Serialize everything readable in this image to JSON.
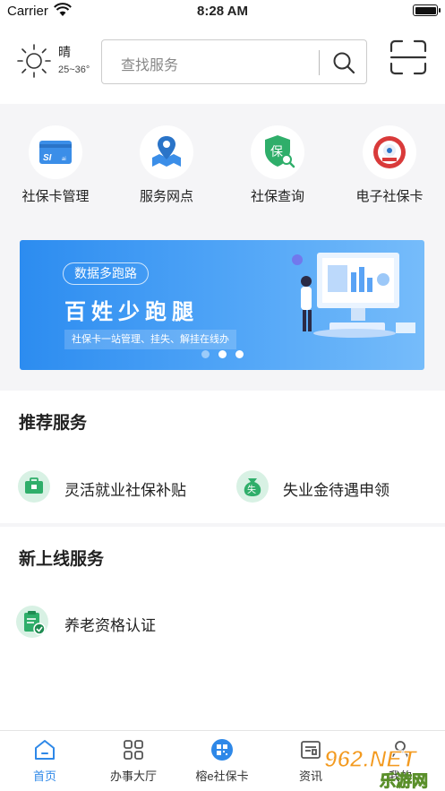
{
  "status_bar": {
    "carrier": "Carrier",
    "time": "8:28 AM"
  },
  "header": {
    "weather": {
      "condition": "晴",
      "temperature": "25~36°",
      "icon": "sun-icon"
    },
    "search": {
      "placeholder": "查找服务",
      "icon": "search-icon"
    },
    "scan": {
      "icon": "scan-icon"
    }
  },
  "quick_actions": [
    {
      "label": "社保卡管理",
      "icon": "si-card-icon"
    },
    {
      "label": "服务网点",
      "icon": "map-pin-icon"
    },
    {
      "label": "社保查询",
      "icon": "shield-search-icon"
    },
    {
      "label": "电子社保卡",
      "icon": "social-security-seal-icon"
    }
  ],
  "banner": {
    "tag": "数据多跑路",
    "headline": "百姓少跑腿",
    "subline": "社保卡一站管理、挂失、解挂在线办",
    "slide_count": 3,
    "active_slide": 1
  },
  "recommended": {
    "title": "推荐服务",
    "items": [
      {
        "label": "灵活就业社保补贴",
        "icon": "briefcase-icon"
      },
      {
        "label": "失业金待遇申领",
        "icon": "money-bag-icon"
      }
    ]
  },
  "new_services": {
    "title": "新上线服务",
    "items": [
      {
        "label": "养老资格认证",
        "icon": "clipboard-check-icon"
      }
    ]
  },
  "tab_bar": [
    {
      "label": "首页",
      "icon": "home-icon",
      "active": true
    },
    {
      "label": "办事大厅",
      "icon": "grid-icon",
      "active": false
    },
    {
      "label": "榕e社保卡",
      "icon": "qr-badge-icon",
      "active": false
    },
    {
      "label": "资讯",
      "icon": "news-icon",
      "active": false
    },
    {
      "label": "我的",
      "icon": "user-icon",
      "active": false
    }
  ],
  "watermark": {
    "brand": "962.NET",
    "caption": "乐游网"
  },
  "colors": {
    "accent": "#2e88e8",
    "green": "#2fae6a",
    "banner": "#3a93f2"
  }
}
